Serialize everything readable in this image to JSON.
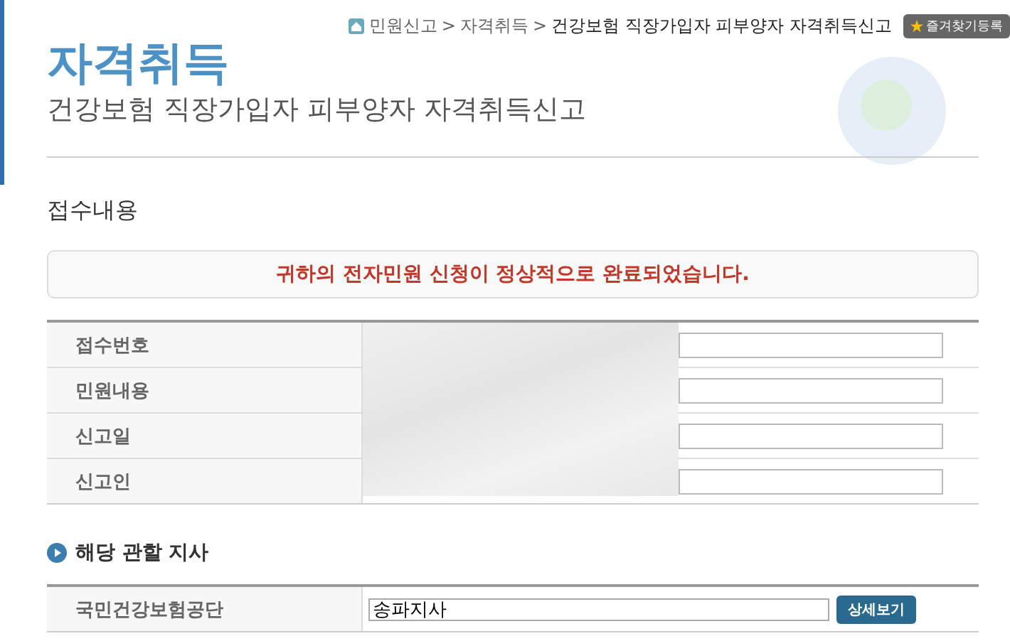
{
  "breadcrumb": {
    "items": [
      "민원신고",
      "자격취득",
      "건강보험 직장가입자 피부양자 자격취득신고"
    ],
    "separator": ">",
    "bookmark_button": "즐겨찾기등록"
  },
  "header": {
    "title": "자격취득",
    "subtitle": "건강보험 직장가입자 피부양자 자격취득신고"
  },
  "section": {
    "title": "접수내용"
  },
  "message": "귀하의 전자민원 신청이 정상적으로 완료되었습니다.",
  "receipt_table": {
    "rows": [
      {
        "label": "접수번호"
      },
      {
        "label": "민원내용"
      },
      {
        "label": "신고일"
      },
      {
        "label": "신고인"
      }
    ]
  },
  "branch_section": {
    "title": "해당 관할 지사",
    "rows": [
      {
        "label": "국민건강보험공단",
        "value": "송파지사",
        "button": "상세보기"
      }
    ]
  }
}
